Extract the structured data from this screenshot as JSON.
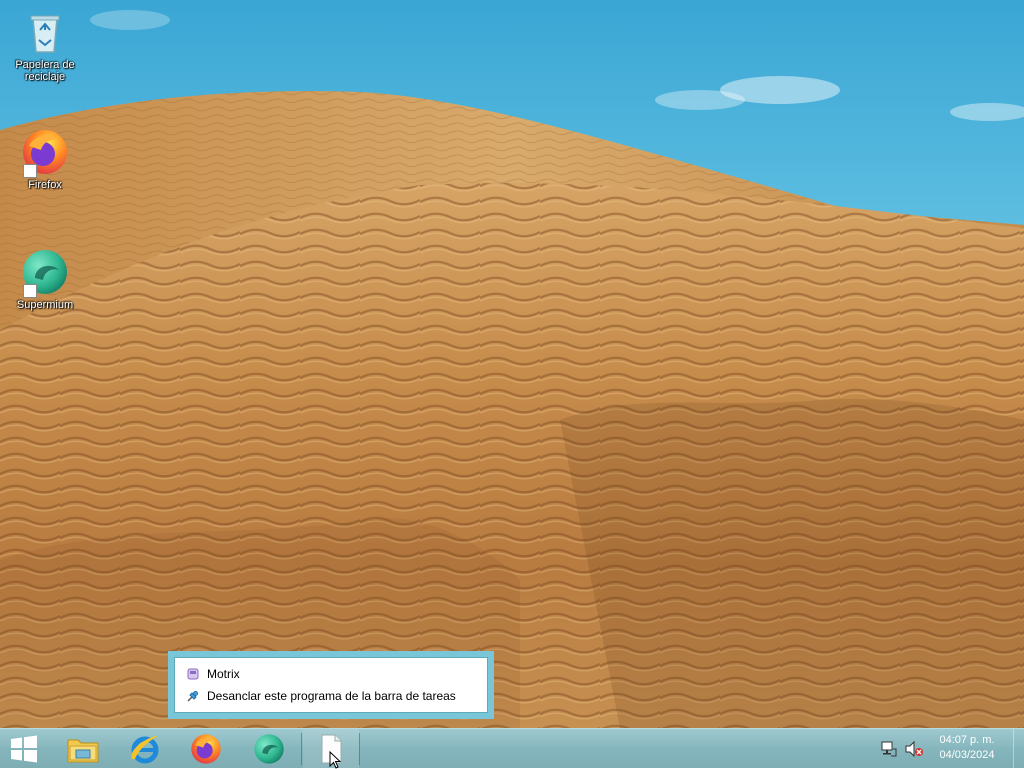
{
  "desktop": {
    "icons": [
      {
        "label": "Papelera de reciclaje",
        "icon": "recycle-bin-icon"
      },
      {
        "label": "Firefox",
        "icon": "firefox-icon"
      },
      {
        "label": "Supermium",
        "icon": "supermium-icon"
      }
    ]
  },
  "jumplist": {
    "app_name": "Motrix",
    "unpin_label": "Desanclar este programa de la barra de tareas"
  },
  "taskbar": {
    "pinned": [
      "start-button",
      "file-explorer-icon",
      "internet-explorer-icon",
      "firefox-icon",
      "supermium-icon",
      "motrix-icon"
    ],
    "tray": {
      "icons": [
        "network-icon",
        "volume-muted-icon"
      ]
    },
    "clock": {
      "time": "04:07 p. m.",
      "date": "04/03/2024"
    }
  },
  "colors": {
    "taskbar": "#86b6bd",
    "jumplist_border": "#78c6d8",
    "sky": "#5cbde0",
    "sand": "#c98f4e"
  }
}
